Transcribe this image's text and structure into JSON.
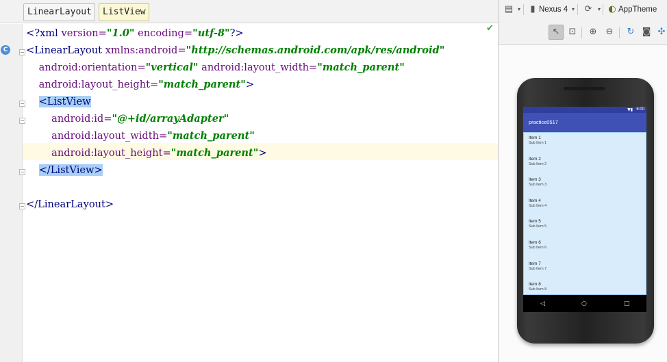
{
  "breadcrumbs": [
    "LinearLayout",
    "ListView"
  ],
  "gutter": {
    "class_marker": "C"
  },
  "code_lines": [
    [
      {
        "t": "<?",
        "c": "tag"
      },
      {
        "t": "xml ",
        "c": "tag"
      },
      {
        "t": "version=",
        "c": "attr"
      },
      {
        "t": "\"1.0\"",
        "c": "val"
      },
      {
        "t": " encoding=",
        "c": "attr"
      },
      {
        "t": "\"utf-8\"",
        "c": "val"
      },
      {
        "t": "?>",
        "c": "tag"
      }
    ],
    [
      {
        "t": "<LinearLayout ",
        "c": "tag"
      },
      {
        "t": "xmlns:android=",
        "c": "attr"
      },
      {
        "t": "\"http://schemas.android.com/apk/res/android\"",
        "c": "val"
      }
    ],
    [
      {
        "t": "    "
      },
      {
        "t": "android:orientation=",
        "c": "attr"
      },
      {
        "t": "\"vertical\"",
        "c": "val"
      },
      {
        "t": " android:layout_width=",
        "c": "attr"
      },
      {
        "t": "\"match_parent\"",
        "c": "val"
      }
    ],
    [
      {
        "t": "    "
      },
      {
        "t": "android:layout_height=",
        "c": "attr"
      },
      {
        "t": "\"match_parent\"",
        "c": "val"
      },
      {
        "t": ">",
        "c": "tag"
      }
    ],
    [
      {
        "t": "    "
      },
      {
        "t": "<ListView",
        "c": "tag hl"
      }
    ],
    [
      {
        "t": "        "
      },
      {
        "t": "android:id=",
        "c": "attr"
      },
      {
        "t": "\"@+id/arrayAdapter\"",
        "c": "val"
      }
    ],
    [
      {
        "t": "        "
      },
      {
        "t": "android:layout_width=",
        "c": "attr"
      },
      {
        "t": "\"match_parent\"",
        "c": "val"
      }
    ],
    [
      {
        "t": "        "
      },
      {
        "t": "android:layout_height=",
        "c": "attr"
      },
      {
        "t": "\"match_parent\"",
        "c": "val"
      },
      {
        "t": ">",
        "c": "tag"
      }
    ],
    [
      {
        "t": "    "
      },
      {
        "t": "</ListView>",
        "c": "tag hl"
      }
    ],
    [],
    [
      {
        "t": "</LinearLayout>",
        "c": "tag"
      }
    ]
  ],
  "toolbar": {
    "device_label": "Nexus 4",
    "theme_label": "AppTheme"
  },
  "phone": {
    "status_time": "6:00",
    "app_title": "practice0517",
    "list_items": [
      {
        "title": "Item 1",
        "sub": "Sub Item 1"
      },
      {
        "title": "Item 2",
        "sub": "Sub Item 2"
      },
      {
        "title": "Item 3",
        "sub": "Sub Item 3"
      },
      {
        "title": "Item 4",
        "sub": "Sub Item 4"
      },
      {
        "title": "Item 5",
        "sub": "Sub Item 5"
      },
      {
        "title": "Item 6",
        "sub": "Sub Item 6"
      },
      {
        "title": "Item 7",
        "sub": "Sub Item 7"
      },
      {
        "title": "Item 8",
        "sub": "Sub Item 8"
      }
    ],
    "nav": {
      "back": "◁",
      "home": "○",
      "recents": "□"
    }
  },
  "colors": {
    "tag": "#000080",
    "attribute": "#660e7a",
    "value": "#008000",
    "tag_highlight": "#a8d0f5",
    "app_bar": "#3f51b5",
    "status_bar": "#303f9f",
    "list_selection": "#d8ecfb"
  }
}
